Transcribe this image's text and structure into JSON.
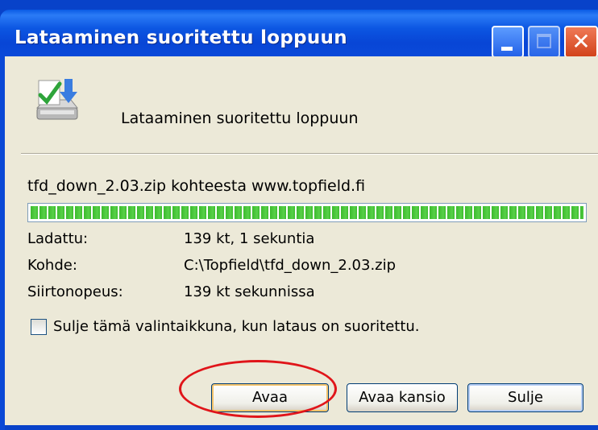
{
  "window": {
    "title": "Lataaminen suoritettu loppuun"
  },
  "header": {
    "message": "Lataaminen suoritettu loppuun",
    "icon": "download-complete-icon"
  },
  "download": {
    "file_line": "tfd_down_2.03.zip kohteesta www.topfield.fi",
    "progress": 1.0
  },
  "info": {
    "downloaded_label": "Ladattu:",
    "downloaded_value": "139 kt, 1 sekuntia",
    "target_label": "Kohde:",
    "target_value": "C:\\Topfield\\tfd_down_2.03.zip",
    "speed_label": "Siirtonopeus:",
    "speed_value": "139 kt sekunnissa"
  },
  "options": {
    "close_when_done_label": "Sulje tämä valintaikkuna, kun lataus on suoritettu.",
    "close_when_done_checked": false
  },
  "buttons": {
    "open": "Avaa",
    "open_folder": "Avaa kansio",
    "close": "Sulje"
  },
  "colors": {
    "titlebar": "#0a49d9",
    "client_bg": "#ece9d8",
    "progress_green": "#3cba2e",
    "highlight_red": "#e0151a"
  }
}
